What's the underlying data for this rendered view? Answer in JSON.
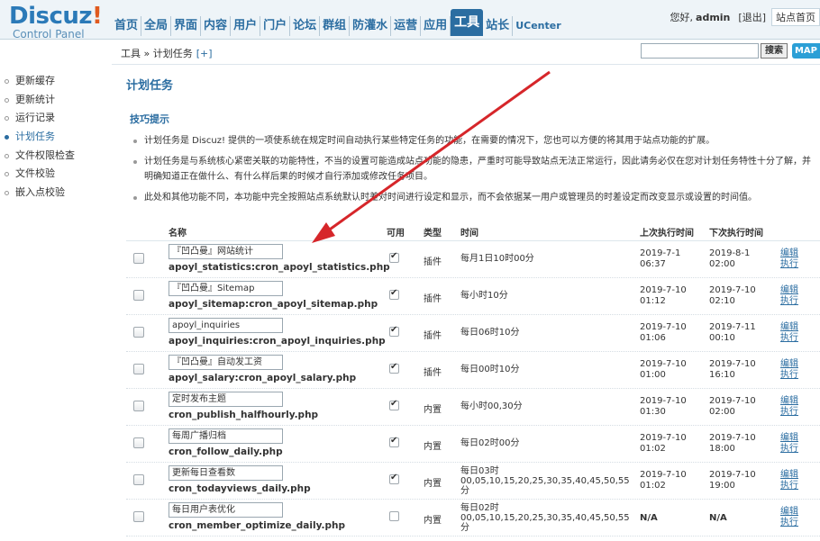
{
  "logo": {
    "main": "Discuz",
    "bang": "!",
    "sub": "Control Panel"
  },
  "nav": [
    "首页",
    "全局",
    "界面",
    "内容",
    "用户",
    "门户",
    "论坛",
    "群组",
    "防灌水",
    "运营",
    "应用",
    "工具",
    "站长",
    "UCenter"
  ],
  "userbar": {
    "greeting": "您好,",
    "user": "admin",
    "logout": "[退出]",
    "home": "站点首页"
  },
  "breadcrumb": {
    "path": "工具 » 计划任务",
    "add": "[+]"
  },
  "search": {
    "button": "搜索",
    "map": "MAP"
  },
  "sidebar": [
    "更新缓存",
    "更新统计",
    "运行记录",
    "计划任务",
    "文件权限检查",
    "文件校验",
    "嵌入点校验"
  ],
  "page_title": "计划任务",
  "tips_title": "技巧提示",
  "tips": [
    "计划任务是 Discuz! 提供的一项使系统在规定时间自动执行某些特定任务的功能，在需要的情况下，您也可以方便的将其用于站点功能的扩展。",
    "计划任务是与系统核心紧密关联的功能特性，不当的设置可能造成站点功能的隐患，严重时可能导致站点无法正常运行，因此请务必仅在您对计划任务特性十分了解，并明确知道正在做什么、有什么样后果的时候才自行添加或修改任务项目。",
    "此处和其他功能不同，本功能中完全按照站点系统默认时差对时间进行设定和显示，而不会依据某一用户或管理员的时差设定而改变显示或设置的时间值。"
  ],
  "table": {
    "headers": {
      "name": "名称",
      "avail": "可用",
      "type": "类型",
      "time": "时间",
      "last": "上次执行时间",
      "next": "下次执行时间"
    },
    "ops": {
      "edit": "编辑",
      "run": "执行"
    },
    "rows": [
      {
        "name": "『凹凸曼』网站统计",
        "file": "apoyl_statistics:cron_apoyl_statistics.php",
        "avail": true,
        "type": "插件",
        "time": "每月1日10时00分",
        "last_date": "2019-7-1",
        "last_time": "06:37",
        "next_date": "2019-8-1",
        "next_time": "02:00"
      },
      {
        "name": "『凹凸曼』Sitemap",
        "file": "apoyl_sitemap:cron_apoyl_sitemap.php",
        "avail": true,
        "type": "插件",
        "time": "每小时10分",
        "last_date": "2019-7-10",
        "last_time": "01:12",
        "next_date": "2019-7-10",
        "next_time": "02:10"
      },
      {
        "name": "apoyl_inquiries",
        "file": "apoyl_inquiries:cron_apoyl_inquiries.php",
        "avail": true,
        "type": "插件",
        "time": "每日06时10分",
        "last_date": "2019-7-10",
        "last_time": "01:06",
        "next_date": "2019-7-11",
        "next_time": "00:10"
      },
      {
        "name": "『凹凸曼』自动发工资",
        "file": "apoyl_salary:cron_apoyl_salary.php",
        "avail": true,
        "type": "插件",
        "time": "每日00时10分",
        "last_date": "2019-7-10",
        "last_time": "01:00",
        "next_date": "2019-7-10",
        "next_time": "16:10"
      },
      {
        "name": "定时发布主题",
        "file": "cron_publish_halfhourly.php",
        "avail": true,
        "type": "内置",
        "time": "每小时00,30分",
        "last_date": "2019-7-10",
        "last_time": "01:30",
        "next_date": "2019-7-10",
        "next_time": "02:00"
      },
      {
        "name": "每周广播归档",
        "file": "cron_follow_daily.php",
        "avail": true,
        "type": "内置",
        "time": "每日02时00分",
        "last_date": "2019-7-10",
        "last_time": "01:02",
        "next_date": "2019-7-10",
        "next_time": "18:00"
      },
      {
        "name": "更新每日查看数",
        "file": "cron_todayviews_daily.php",
        "avail": true,
        "type": "内置",
        "time": "每日03时 00,05,10,15,20,25,30,35,40,45,50,55分",
        "last_date": "2019-7-10",
        "last_time": "01:02",
        "next_date": "2019-7-10",
        "next_time": "19:00"
      },
      {
        "name": "每日用户表优化",
        "file": "cron_member_optimize_daily.php",
        "avail": false,
        "type": "内置",
        "time": "每日02时 00,05,10,15,20,25,30,35,40,45,50,55分",
        "last_date": "N/A",
        "last_time": "",
        "next_date": "N/A",
        "next_time": ""
      }
    ]
  },
  "colors": {
    "accent": "#2b6da1",
    "logo_blue": "#2b7ab8",
    "logo_bang": "#e05a1f",
    "arrow": "#d6262a"
  }
}
